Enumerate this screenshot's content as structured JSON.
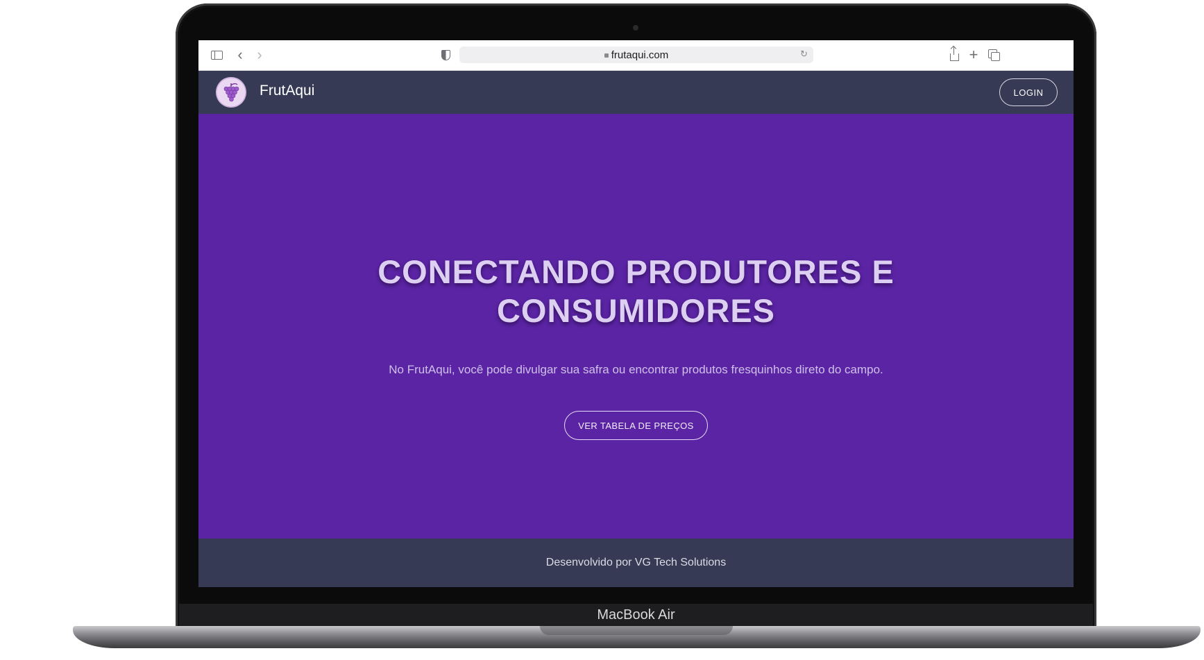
{
  "device": {
    "label": "MacBook Air"
  },
  "browser": {
    "url": "frutaqui.com",
    "icons": [
      "sidebar-icon",
      "back-icon",
      "forward-icon",
      "shield-icon",
      "lock-icon",
      "reload-icon",
      "share-icon",
      "plus-icon",
      "tabs-icon"
    ]
  },
  "site": {
    "brand": "FrutAqui",
    "logo_icon": "grapes-icon",
    "login_label": "LOGIN",
    "hero": {
      "title_line1": "CONECTANDO PRODUTORES E",
      "title_line2": "CONSUMIDORES",
      "subtitle": "No FrutAqui, você pode divulgar sua safra ou encontrar produtos fresquinhos direto do campo.",
      "cta_label": "VER TABELA DE PREÇOS"
    },
    "footer": "Desenvolvido por VG Tech Solutions"
  },
  "colors": {
    "nav_bg": "#363a54",
    "hero_bg": "#5b24a4",
    "title_color": "#ddcff2",
    "logo_bg": "#ead7f2"
  }
}
